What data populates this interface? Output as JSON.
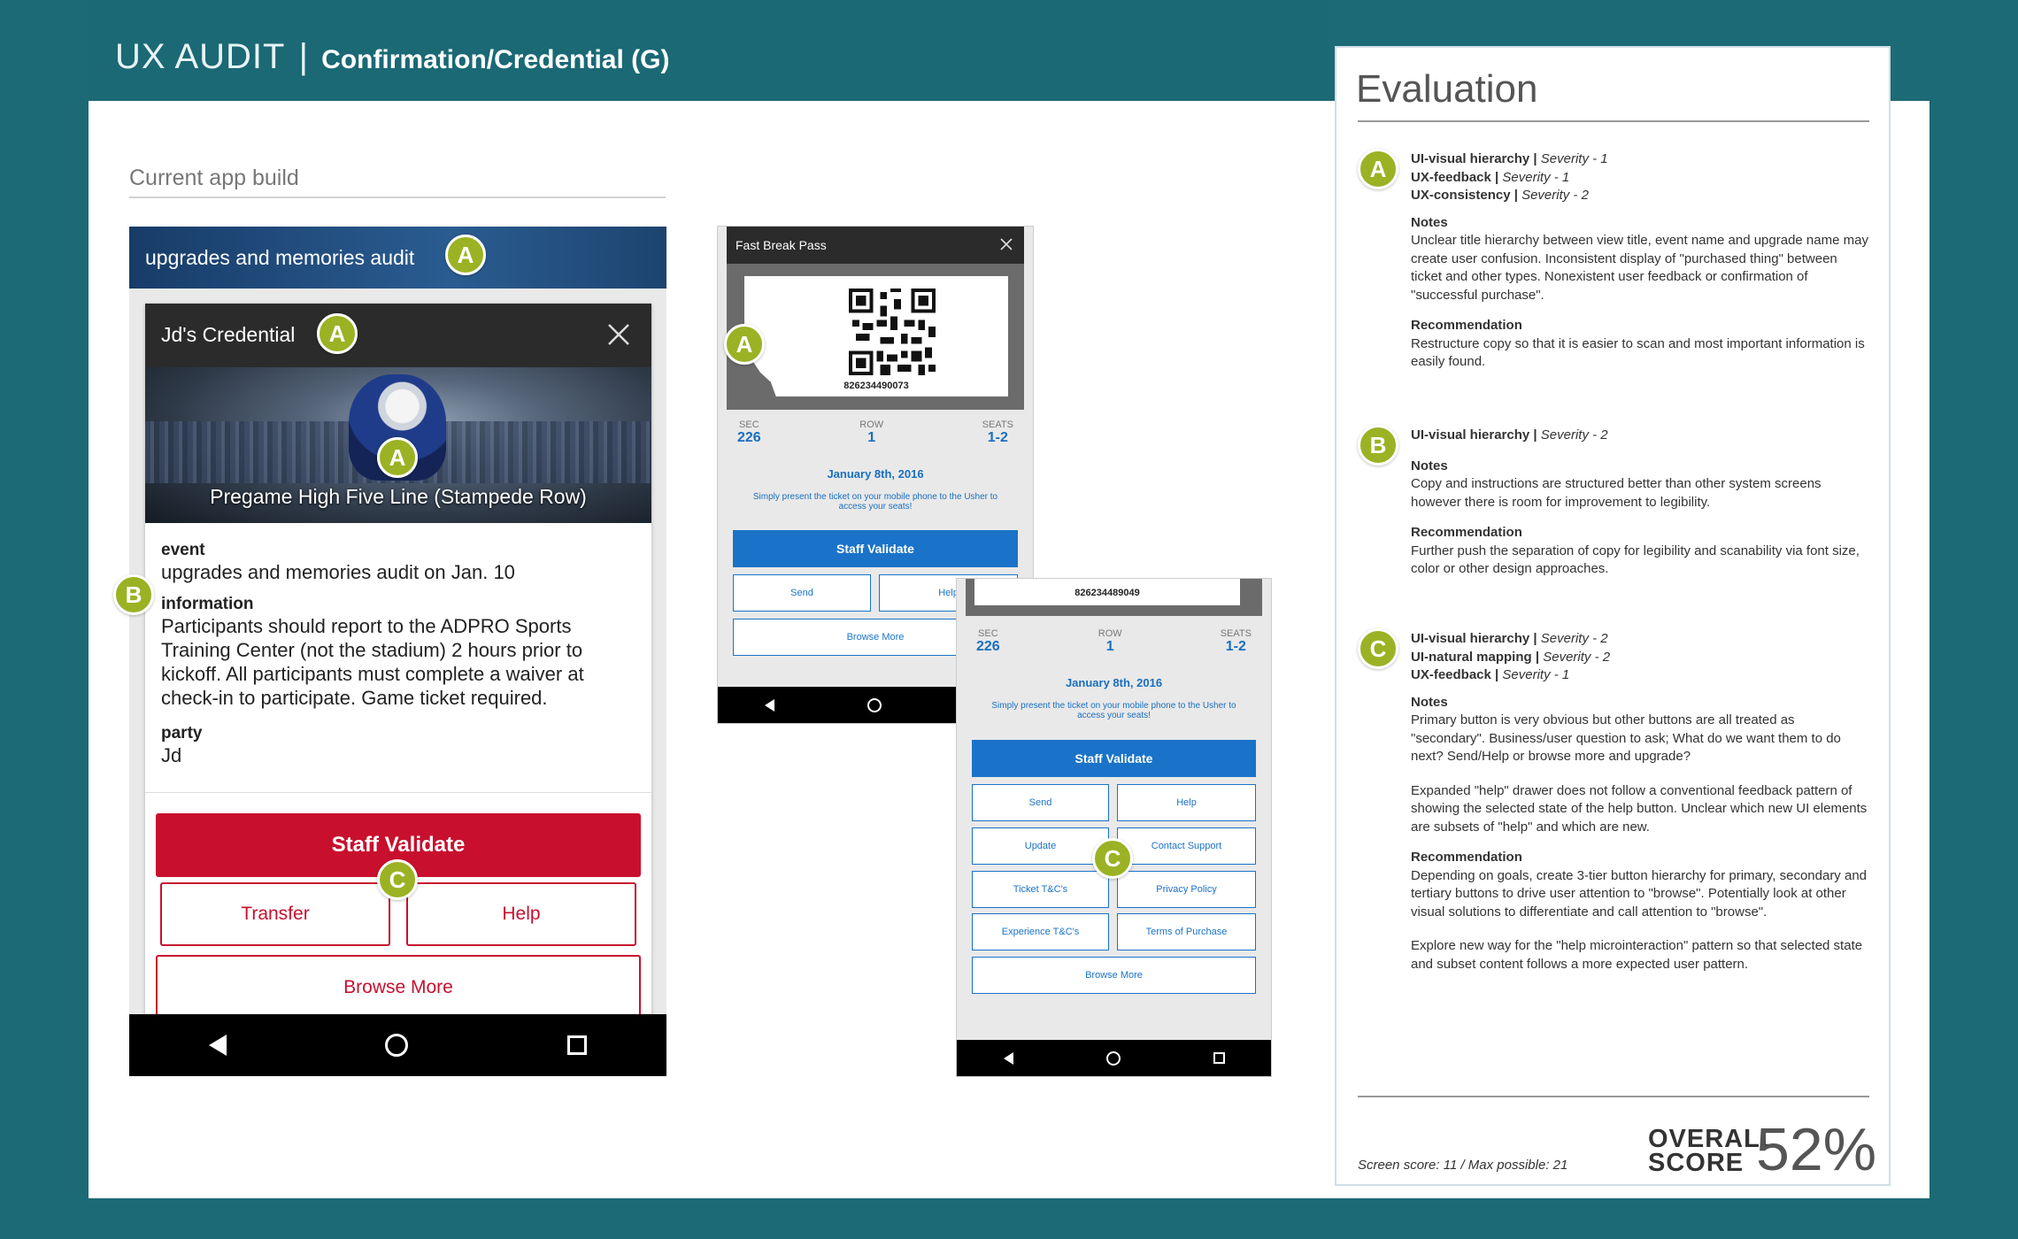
{
  "header": {
    "title_thin": "UX AUDIT",
    "separator": "|",
    "title_bold": "Confirmation/Credential (G)"
  },
  "section": {
    "label": "Current app build"
  },
  "phone1": {
    "header_title": "upgrades and memories audit",
    "card_title": "Jd's Credential",
    "hero_caption": "Pregame High Five Line (Stampede Row)",
    "event_label": "event",
    "event_value": "upgrades and memories audit on Jan. 10",
    "info_label": "information",
    "info_value": "Participants should report to the ADPRO Sports Training Center (not the stadium) 2 hours prior to kickoff. All participants must complete a waiver at check-in to participate. Game ticket required.",
    "party_label": "party",
    "party_value": "Jd",
    "primary_button": "Staff Validate",
    "transfer_button": "Transfer",
    "help_button": "Help",
    "browse_button": "Browse More"
  },
  "phone2": {
    "header_title": "Fast Break Pass",
    "ticket_number": "826234490073",
    "sec_label": "SEC",
    "sec_value": "226",
    "row_label": "ROW",
    "row_value": "1",
    "seats_label": "SEATS",
    "seats_value": "1-2",
    "date": "January 8th, 2016",
    "note": "Simply present the ticket on your mobile phone to the Usher to access your seats!",
    "primary_button": "Staff Validate",
    "send_button": "Send",
    "help_button": "Help",
    "browse_button": "Browse More"
  },
  "phone3": {
    "ticket_number": "826234489049",
    "sec_label": "SEC",
    "sec_value": "226",
    "row_label": "ROW",
    "row_value": "1",
    "seats_label": "SEATS",
    "seats_value": "1-2",
    "date": "January 8th, 2016",
    "note": "Simply present the ticket on your mobile phone to the Usher to access your seats!",
    "primary_button": "Staff Validate",
    "send_button": "Send",
    "help_button": "Help",
    "update_button": "Update",
    "contact_button": "Contact Support",
    "ticket_tc_button": "Ticket T&C's",
    "privacy_button": "Privacy Policy",
    "experience_tc_button": "Experience T&C's",
    "terms_button": "Terms of Purchase",
    "browse_button": "Browse More"
  },
  "badges": {
    "a": "A",
    "b": "B",
    "c": "C"
  },
  "evaluation": {
    "title": "Evaluation",
    "A": {
      "line1_h": "UI-visual hierarchy |",
      "line1_s": "Severity - 1",
      "line2_h": "UX-feedback |",
      "line2_s": "Severity - 1",
      "line3_h": "UX-consistency |",
      "line3_s": "Severity - 2",
      "notes_label": "Notes",
      "notes": "Unclear title hierarchy between view title, event name and upgrade name may create user confusion. Inconsistent display of \"purchased thing\" between ticket and other types. Nonexistent user feedback or confirmation of \"successful purchase\".",
      "rec_label": "Recommendation",
      "rec": "Restructure copy so that it is easier to scan and most important information is easily found."
    },
    "B": {
      "line1_h": "UI-visual hierarchy |",
      "line1_s": "Severity - 2",
      "notes_label": "Notes",
      "notes": "Copy and instructions are structured better than other system screens however there is room for improvement to legibility.",
      "rec_label": "Recommendation",
      "rec": "Further push the separation of copy for legibility and scanability via font size, color or other design approaches."
    },
    "C": {
      "line1_h": "UI-visual hierarchy |",
      "line1_s": "Severity - 2",
      "line2_h": "UI-natural mapping |",
      "line2_s": "Severity - 2",
      "line3_h": "UX-feedback |",
      "line3_s": "Severity - 1",
      "notes_label": "Notes",
      "notes1": "Primary button is very obvious but other buttons are all treated as \"secondary\". Business/user question to ask; What do we want them to do next? Send/Help or browse more and upgrade?",
      "notes2": "Expanded \"help\" drawer does not follow a conventional feedback pattern of showing the selected state of the help button. Unclear which new UI elements are subsets of \"help\" and which are new.",
      "rec_label": "Recommendation",
      "rec1": "Depending on goals, create 3-tier button hierarchy for primary, secondary and tertiary buttons to drive user attention to \"browse\". Potentially look at other visual solutions to differentiate and call attention to \"browse\".",
      "rec2": "Explore new way for the \"help microinteraction\" pattern so that selected state and subset content follows a more expected user pattern."
    },
    "screen_score": "Screen score: 11 / Max possible: 21",
    "overall_line1": "OVERALL",
    "overall_line2": "SCORE",
    "overall_percent": "52%"
  },
  "colors": {
    "background": "#1c6a76",
    "badge": "#9bb224",
    "primary_red": "#c8102e",
    "primary_blue": "#1a73c8"
  }
}
